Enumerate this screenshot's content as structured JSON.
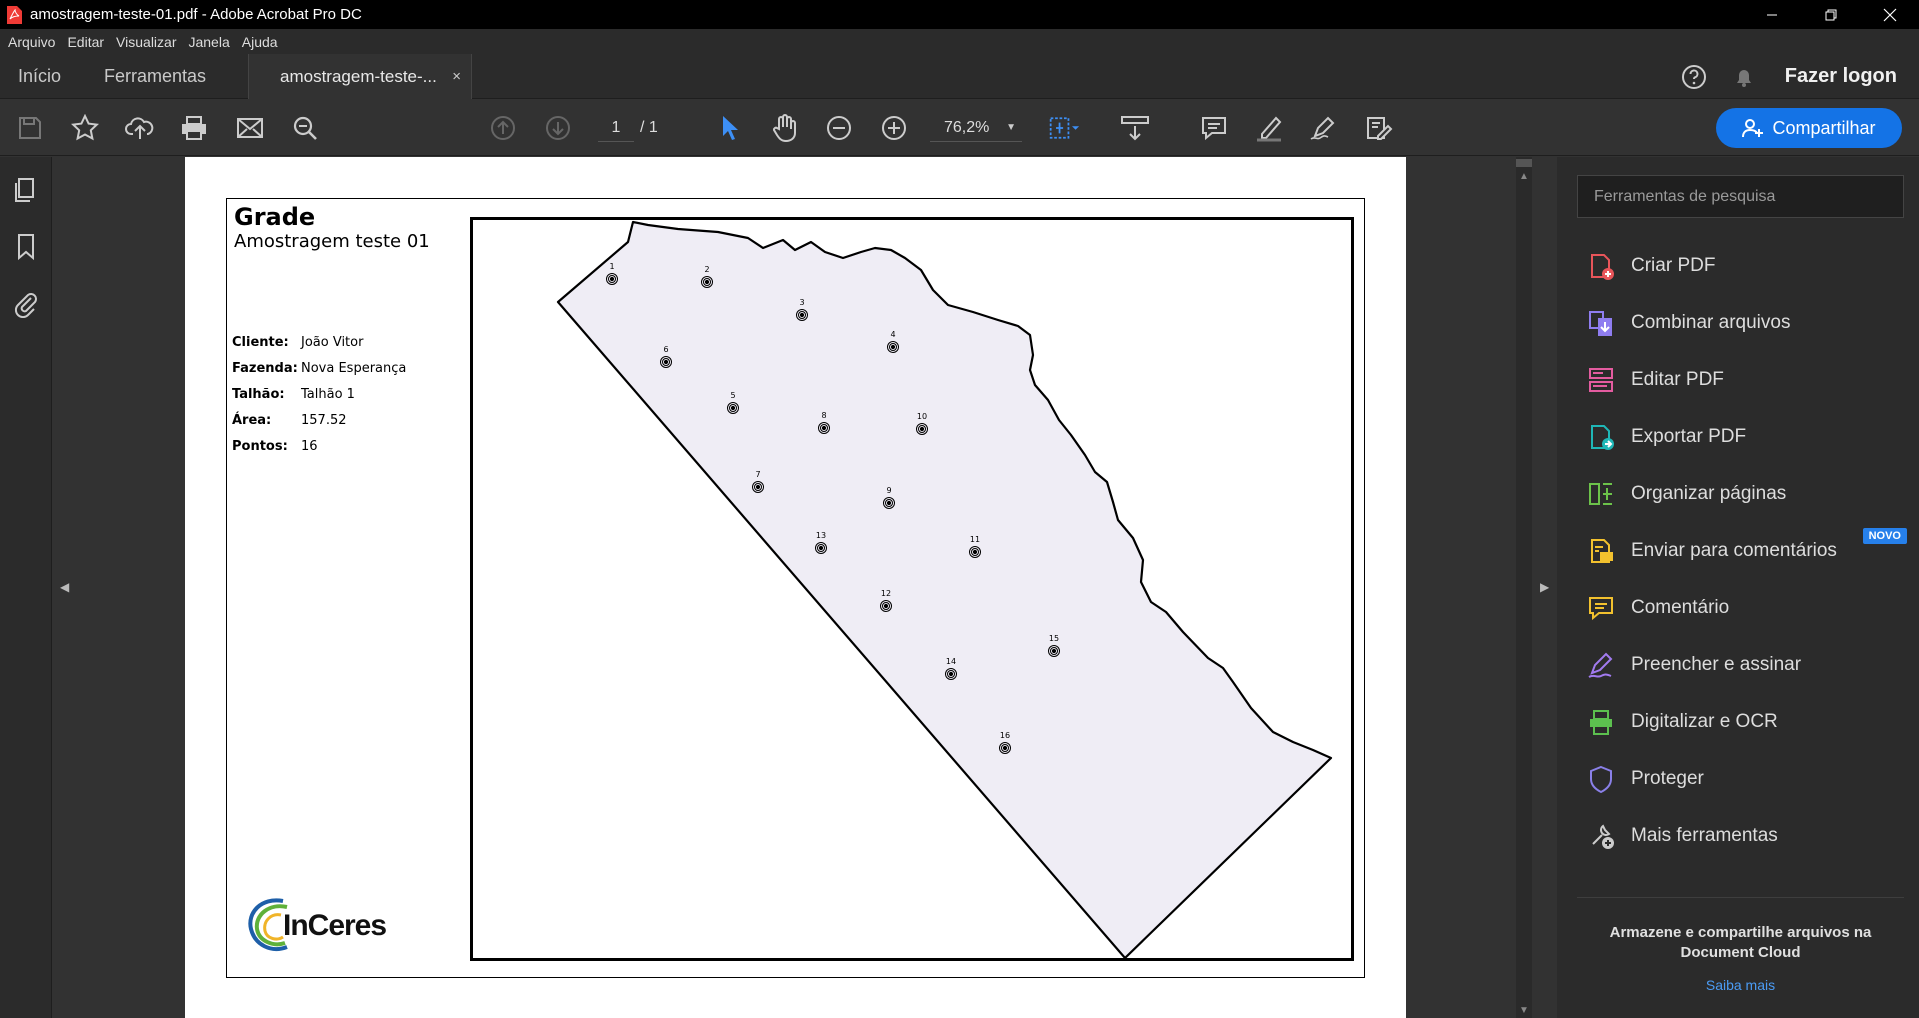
{
  "window": {
    "title": "amostragem-teste-01.pdf - Adobe Acrobat Pro DC"
  },
  "menu": [
    "Arquivo",
    "Editar",
    "Visualizar",
    "Janela",
    "Ajuda"
  ],
  "tabs": {
    "home": "Início",
    "tools": "Ferramentas",
    "document": "amostragem-teste-...",
    "close": "×"
  },
  "account": {
    "login": "Fazer logon"
  },
  "toolbar": {
    "page_current": "1",
    "page_total": "/ 1",
    "zoom": "76,2%",
    "share_label": "Compartilhar"
  },
  "document": {
    "title": "Grade",
    "subtitle": "Amostragem teste 01",
    "info": [
      {
        "key": "Cliente:",
        "value": "João Vitor"
      },
      {
        "key": "Fazenda:",
        "value": "Nova Esperança"
      },
      {
        "key": "Talhão:",
        "value": "Talhão 1"
      },
      {
        "key": "Área:",
        "value": "157.52"
      },
      {
        "key": "Pontos:",
        "value": "16"
      }
    ],
    "logo_text": "InCeres",
    "points": [
      {
        "label": "1"
      },
      {
        "label": "2"
      },
      {
        "label": "3"
      },
      {
        "label": "4"
      },
      {
        "label": "5"
      },
      {
        "label": "6"
      },
      {
        "label": "7"
      },
      {
        "label": "8"
      },
      {
        "label": "9"
      },
      {
        "label": "10"
      },
      {
        "label": "11"
      },
      {
        "label": "12"
      },
      {
        "label": "13"
      },
      {
        "label": "14"
      },
      {
        "label": "15"
      },
      {
        "label": "16"
      }
    ]
  },
  "right_panel": {
    "search_placeholder": "Ferramentas de pesquisa",
    "tools": [
      {
        "label": "Criar PDF",
        "icon": "create-pdf-icon",
        "color": "#e8555a"
      },
      {
        "label": "Combinar arquivos",
        "icon": "combine-files-icon",
        "color": "#8f7df0"
      },
      {
        "label": "Editar PDF",
        "icon": "edit-pdf-icon",
        "color": "#e45ca0"
      },
      {
        "label": "Exportar PDF",
        "icon": "export-pdf-icon",
        "color": "#1fb7b7"
      },
      {
        "label": "Organizar páginas",
        "icon": "organize-pages-icon",
        "color": "#6cc24a"
      },
      {
        "label": "Enviar para comentários",
        "icon": "send-comments-icon",
        "color": "#f2c12e",
        "badge": "NOVO"
      },
      {
        "label": "Comentário",
        "icon": "comment-icon",
        "color": "#f2c12e"
      },
      {
        "label": "Preencher e assinar",
        "icon": "fill-sign-icon",
        "color": "#a27bf0"
      },
      {
        "label": "Digitalizar e OCR",
        "icon": "scan-ocr-icon",
        "color": "#5cc04f"
      },
      {
        "label": "Proteger",
        "icon": "protect-icon",
        "color": "#8a80e8"
      },
      {
        "label": "Mais ferramentas",
        "icon": "more-tools-icon",
        "color": "#cccccc"
      }
    ],
    "promo_text": "Armazene e compartilhe arquivos na Document Cloud",
    "promo_link": "Saiba mais"
  }
}
